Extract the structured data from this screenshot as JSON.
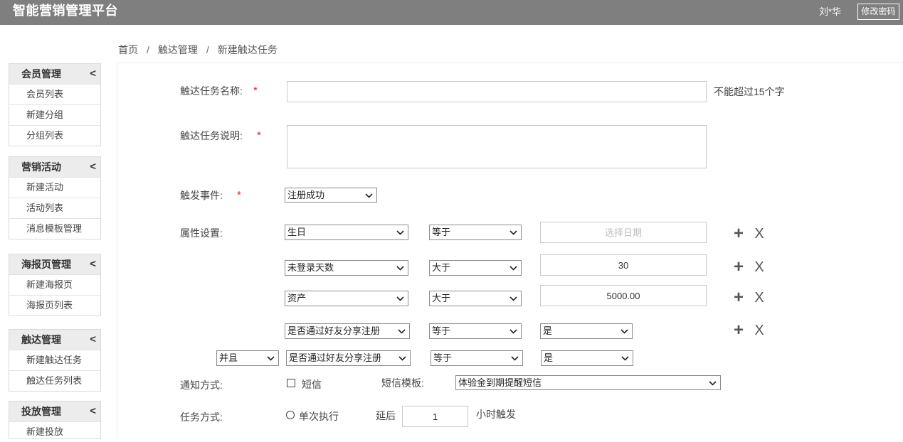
{
  "header": {
    "title": "智能营销管理平台",
    "user_name": "刘*华",
    "change_password_label": "修改密码"
  },
  "breadcrumb": {
    "items": [
      "首页",
      "触达管理",
      "新建触达任务"
    ],
    "separator": "/"
  },
  "sidebar": {
    "collapse_glyph": "<",
    "groups": [
      {
        "title": "会员管理",
        "items": [
          "会员列表",
          "新建分组",
          "分组列表"
        ]
      },
      {
        "title": "营销活动",
        "items": [
          "新建活动",
          "活动列表",
          "消息模板管理"
        ]
      },
      {
        "title": "海报页管理",
        "items": [
          "新建海报页",
          "海报页列表"
        ]
      },
      {
        "title": "触达管理",
        "items": [
          "新建触达任务",
          "触达任务列表"
        ]
      },
      {
        "title": "投放管理",
        "items": [
          "新建投放"
        ]
      }
    ]
  },
  "form": {
    "required_mark": "*",
    "task_name": {
      "label": "触达任务名称:",
      "value": "",
      "hint": "不能超过15个字"
    },
    "task_description": {
      "label": "触达任务说明:",
      "value": ""
    },
    "trigger_event": {
      "label": "触发事件:",
      "value": "注册成功"
    },
    "attributes": {
      "label": "属性设置:",
      "add_glyph": "+",
      "remove_glyph": "X",
      "rows": [
        {
          "field": "生日",
          "operator": "等于",
          "value": "",
          "placeholder": "选择日期"
        },
        {
          "field": "未登录天数",
          "operator": "大于",
          "value": "30"
        },
        {
          "field": "资产",
          "operator": "大于",
          "value": "5000.00"
        },
        {
          "field": "是否通过好友分享注册",
          "operator": "等于",
          "value": "是"
        },
        {
          "connector": "并且",
          "field": "是否通过好友分享注册",
          "operator": "等于",
          "value": "是"
        }
      ]
    },
    "notification": {
      "label": "通知方式:",
      "sms_label": "短信",
      "sms_checked": false,
      "template_label": "短信模板:",
      "template_value": "体验金到期提醒短信"
    },
    "task_mode": {
      "label": "任务方式:",
      "single_label": "单次执行",
      "single_selected": false,
      "delay_label": "延后",
      "delay_value": "1",
      "delay_unit": "小时触发"
    }
  },
  "colors": {
    "header_bg": "#7f7f7f",
    "required_mark": "#e02020",
    "sidebar_header_bg": "#ececec"
  }
}
